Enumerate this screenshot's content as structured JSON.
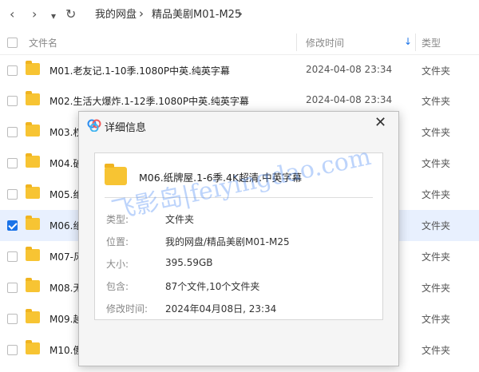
{
  "toolbar": {
    "back_icon": "‹",
    "forward_icon": "›",
    "dropdown_icon": "▾",
    "refresh_icon": "↻",
    "breadcrumb": [
      "我的网盘",
      "精品美剧M01-M25"
    ],
    "separator": "›"
  },
  "header": {
    "name": "文件名",
    "modified": "修改时间",
    "sort_icon": "↓",
    "type": "类型"
  },
  "rows": [
    {
      "name": "M01.老友记.1-10季.1080P中英.纯英字幕",
      "date": "2024-04-08 23:34",
      "type": "文件夹"
    },
    {
      "name": "M02.生活大爆炸.1-12季.1080P中英.纯英字幕",
      "date": "2024-04-08 23:34",
      "type": "文件夹"
    },
    {
      "name": "M03.权",
      "date": "",
      "type": "文件夹"
    },
    {
      "name": "M04.破",
      "date": "",
      "type": "文件夹"
    },
    {
      "name": "M05.绝",
      "date": "",
      "type": "文件夹"
    },
    {
      "name": "M06.纸",
      "date": "",
      "type": "文件夹"
    },
    {
      "name": "M07-风",
      "date": "",
      "type": "文件夹"
    },
    {
      "name": "M08.无",
      "date": "",
      "type": "文件夹"
    },
    {
      "name": "M09.越",
      "date": "",
      "type": "文件夹"
    },
    {
      "name": "M10.傲",
      "date": "",
      "type": "文件夹"
    }
  ],
  "dialog": {
    "title": "详细信息",
    "close_icon": "✕",
    "folder_name": "M06.纸牌屋.1-6季.4K超清.中英字幕",
    "fields": [
      {
        "label": "类型:",
        "value": "文件夹"
      },
      {
        "label": "位置:",
        "value": "我的网盘/精品美剧M01-M25"
      },
      {
        "label": "大小:",
        "value": "395.59GB"
      },
      {
        "label": "包含:",
        "value": "87个文件,10个文件夹"
      },
      {
        "label": "修改时间:",
        "value": "2024年04月08日, 23:34"
      }
    ]
  },
  "watermark": "飞影岛|feiyingdao.com",
  "colors": {
    "accent": "#1a73e8",
    "folder": "#f7c433",
    "selected_row": "#e8f0fe"
  }
}
